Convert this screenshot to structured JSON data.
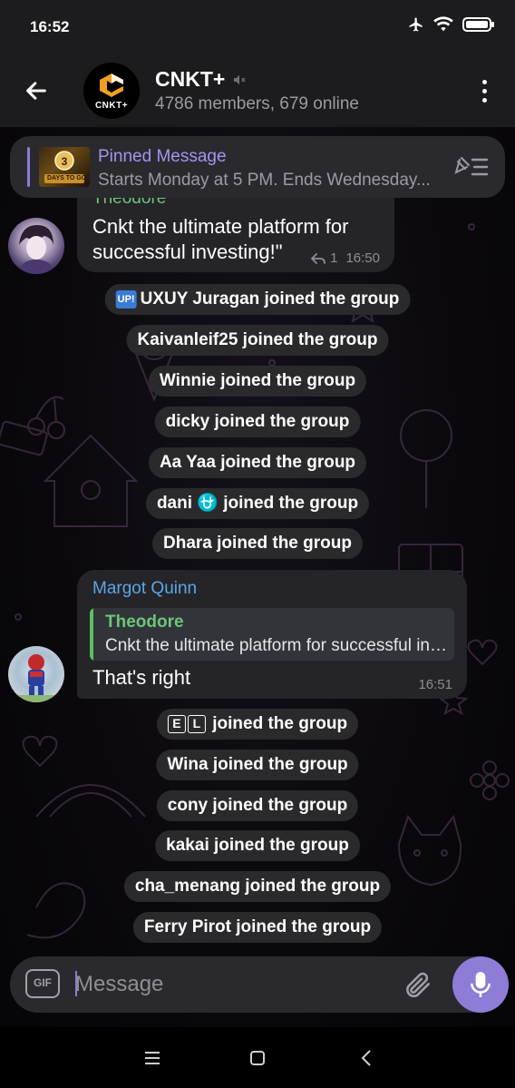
{
  "status_bar": {
    "time": "16:52"
  },
  "header": {
    "title": "CNKT+",
    "subtitle": "4786 members, 679 online",
    "avatar_text": "CNKT+"
  },
  "pinned": {
    "title": "Pinned Message",
    "text": "Starts Monday at 5 PM. Ends Wednesday...",
    "thumb_text": "DAYS TO GO"
  },
  "messages": [
    {
      "sender": "Theodore",
      "text": "Cnkt the ultimate platform for successful investing!\"",
      "reply_count": "1",
      "time": "16:50"
    },
    {
      "sender": "Margot Quinn",
      "reply_to_name": "Theodore",
      "reply_to_text": "Cnkt the ultimate platform for successful investing!\"",
      "text": "That's right",
      "time": "16:51"
    }
  ],
  "service_messages": [
    {
      "badge": "UP!",
      "text": "UXUY Juragan joined the group"
    },
    {
      "text": "Kaivanleif25 joined the group"
    },
    {
      "text": "Winnie joined the group"
    },
    {
      "text": "dicky joined the group"
    },
    {
      "text": "Aa Yaa joined the group"
    },
    {
      "name": "dani",
      "emoji": "⛎",
      "suffix": "joined the group"
    },
    {
      "text": "Dhara joined the group"
    },
    {
      "letters": [
        "E",
        "L"
      ],
      "suffix": "joined the group"
    },
    {
      "text": "Wina joined the group"
    },
    {
      "text": "cony joined the group"
    },
    {
      "text": "kakai joined the group"
    },
    {
      "text": "cha_menang joined the group"
    },
    {
      "text": "Ferry Pirot joined the group"
    }
  ],
  "input": {
    "placeholder": "Message",
    "gif_label": "GIF"
  },
  "colors": {
    "accent": "#8e7cd6",
    "sender_theodore": "#6ec578",
    "sender_margot": "#5ba7e6",
    "bubble": "#252428",
    "header": "#1c1c1e"
  }
}
